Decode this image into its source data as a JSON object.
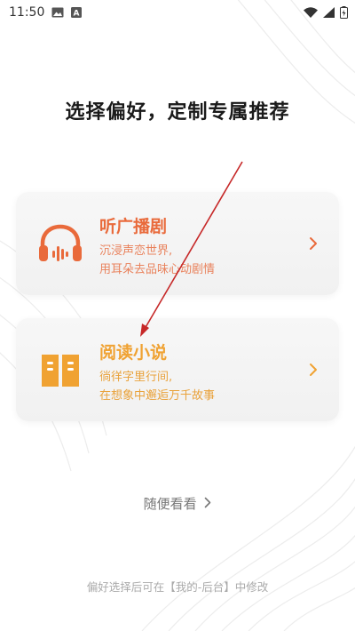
{
  "status_bar": {
    "time": "11:50",
    "icons": [
      "image-icon",
      "a-badge-icon",
      "wifi-icon",
      "signal-icon",
      "battery-icon"
    ]
  },
  "page": {
    "title": "选择偏好，定制专属推荐"
  },
  "options": [
    {
      "title": "听广播剧",
      "desc_line1": "沉浸声恋世界,",
      "desc_line2": "用耳朵去品味心动剧情",
      "icon": "headphones-icon",
      "color": "#e96a3b"
    },
    {
      "title": "阅读小说",
      "desc_line1": "徜徉字里行间,",
      "desc_line2": "在想象中邂逅万千故事",
      "icon": "book-icon",
      "color": "#f0a232"
    }
  ],
  "skip_label": "随便看看",
  "footer_note": "偏好选择后可在【我的-后台】中修改",
  "annotation_color": "#c62828"
}
